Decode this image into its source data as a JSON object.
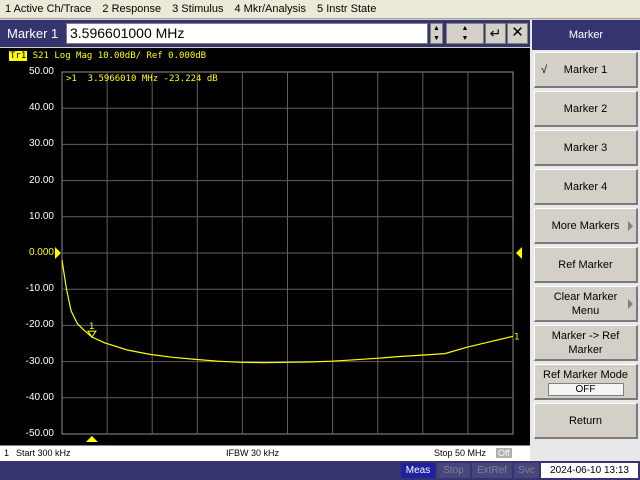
{
  "menubar": {
    "items": [
      "1 Active Ch/Trace",
      "2 Response",
      "3 Stimulus",
      "4 Mkr/Analysis",
      "5 Instr State"
    ]
  },
  "entry": {
    "label": "Marker 1",
    "value": "3.596601000 MHz",
    "enter_glyph": "↵",
    "close_glyph": "✕"
  },
  "trace": {
    "id": "Tr1",
    "header": "S21 Log Mag 10.00dB/ Ref 0.000dB",
    "marker_readout": ">1  3.5966010 MHz -23.224 dB",
    "marker_label": "1",
    "end_label": "1",
    "color": "#ffff00"
  },
  "chart_data": {
    "type": "line",
    "ylim": [
      -50,
      50
    ],
    "xlim_mhz": [
      0.3,
      50
    ],
    "y_ticks": [
      "50.00",
      "40.00",
      "30.00",
      "20.00",
      "10.00",
      "0.000",
      "-10.00",
      "-20.00",
      "-30.00",
      "-40.00",
      "-50.00"
    ],
    "ref_level": "0.000",
    "grid": true,
    "series": [
      {
        "x_mhz": [
          0.3,
          0.8,
          1.3,
          2.0,
          2.8,
          3.6,
          5.0,
          7.5,
          10.0,
          12.5,
          15.0,
          17.5,
          20.0,
          22.5,
          25.0,
          27.5,
          30.0,
          32.5,
          35.0,
          37.5,
          40.0,
          42.5,
          45.0,
          47.5,
          50.0
        ],
        "y_db": [
          -2.0,
          -10.0,
          -16.0,
          -19.5,
          -21.5,
          -23.2,
          -24.8,
          -26.8,
          -28.0,
          -28.8,
          -29.4,
          -29.9,
          -30.2,
          -30.3,
          -30.2,
          -30.1,
          -29.9,
          -29.5,
          -29.1,
          -28.6,
          -28.2,
          -27.8,
          -26.0,
          -24.5,
          -23.0
        ]
      }
    ],
    "marker_x_mhz": 3.5966,
    "marker_y_db": -23.224
  },
  "channel_status": {
    "channel": "1",
    "start": "Start 300 kHz",
    "ifbw": "IFBW 30 kHz",
    "stop": "Stop 50 MHz",
    "off": "Off"
  },
  "instrument_status": {
    "meas": "Meas",
    "stop": "Stop",
    "extref": "ExtRef",
    "svc": "Svc",
    "datetime": "2024-06-10 13:13"
  },
  "softkeys": {
    "title": "Marker",
    "check_glyph": "√",
    "items": [
      {
        "label": "Marker 1"
      },
      {
        "label": "Marker 2"
      },
      {
        "label": "Marker 3"
      },
      {
        "label": "Marker 4"
      },
      {
        "label": "More Markers"
      },
      {
        "label": "Ref Marker"
      },
      {
        "label": "Clear Marker Menu"
      },
      {
        "label": "Marker -> Ref Marker"
      },
      {
        "label": "Ref Marker Mode",
        "value": "OFF"
      },
      {
        "label": "Return"
      }
    ]
  }
}
